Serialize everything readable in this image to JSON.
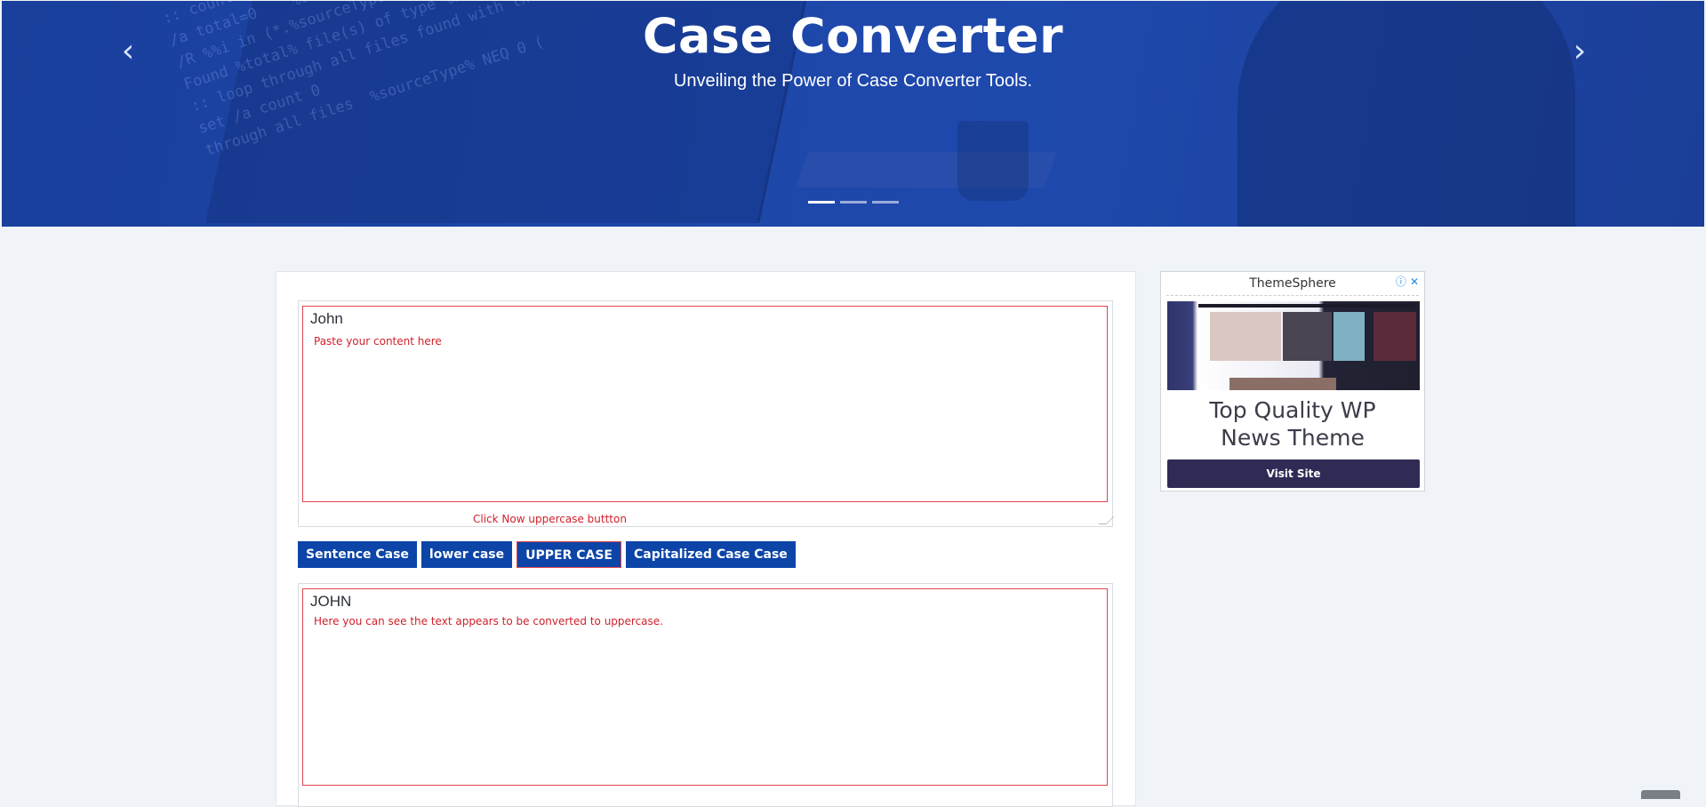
{
  "hero": {
    "title": "Case Converter",
    "subtitle": "Unveiling the Power of Case Converter Tools.",
    "prev_icon": "chevron-left-icon",
    "next_icon": "chevron-right-icon",
    "slide_count": 3,
    "active_slide": 1
  },
  "input": {
    "value": "John",
    "note": "Paste your content here",
    "hint": "Click Now uppercase buttton"
  },
  "buttons": {
    "sentence": "Sentence Case",
    "lower": "lower case",
    "upper": "UPPER CASE",
    "capitalized": "Capitalized Case Case"
  },
  "output": {
    "value": "JOHN",
    "note": "Here you can see the text appears to be converted to uppercase."
  },
  "ad": {
    "brand": "ThemeSphere",
    "info_icon": "info-icon",
    "close_icon": "close-icon",
    "headline_line1": "Top Quality WP",
    "headline_line2": "News Theme",
    "button": "Visit Site"
  },
  "colors": {
    "hero_blue": "#1d46a8",
    "button_blue": "#0c44a8",
    "highlight_red": "#e0454f",
    "ad_button": "#2f2b55"
  }
}
